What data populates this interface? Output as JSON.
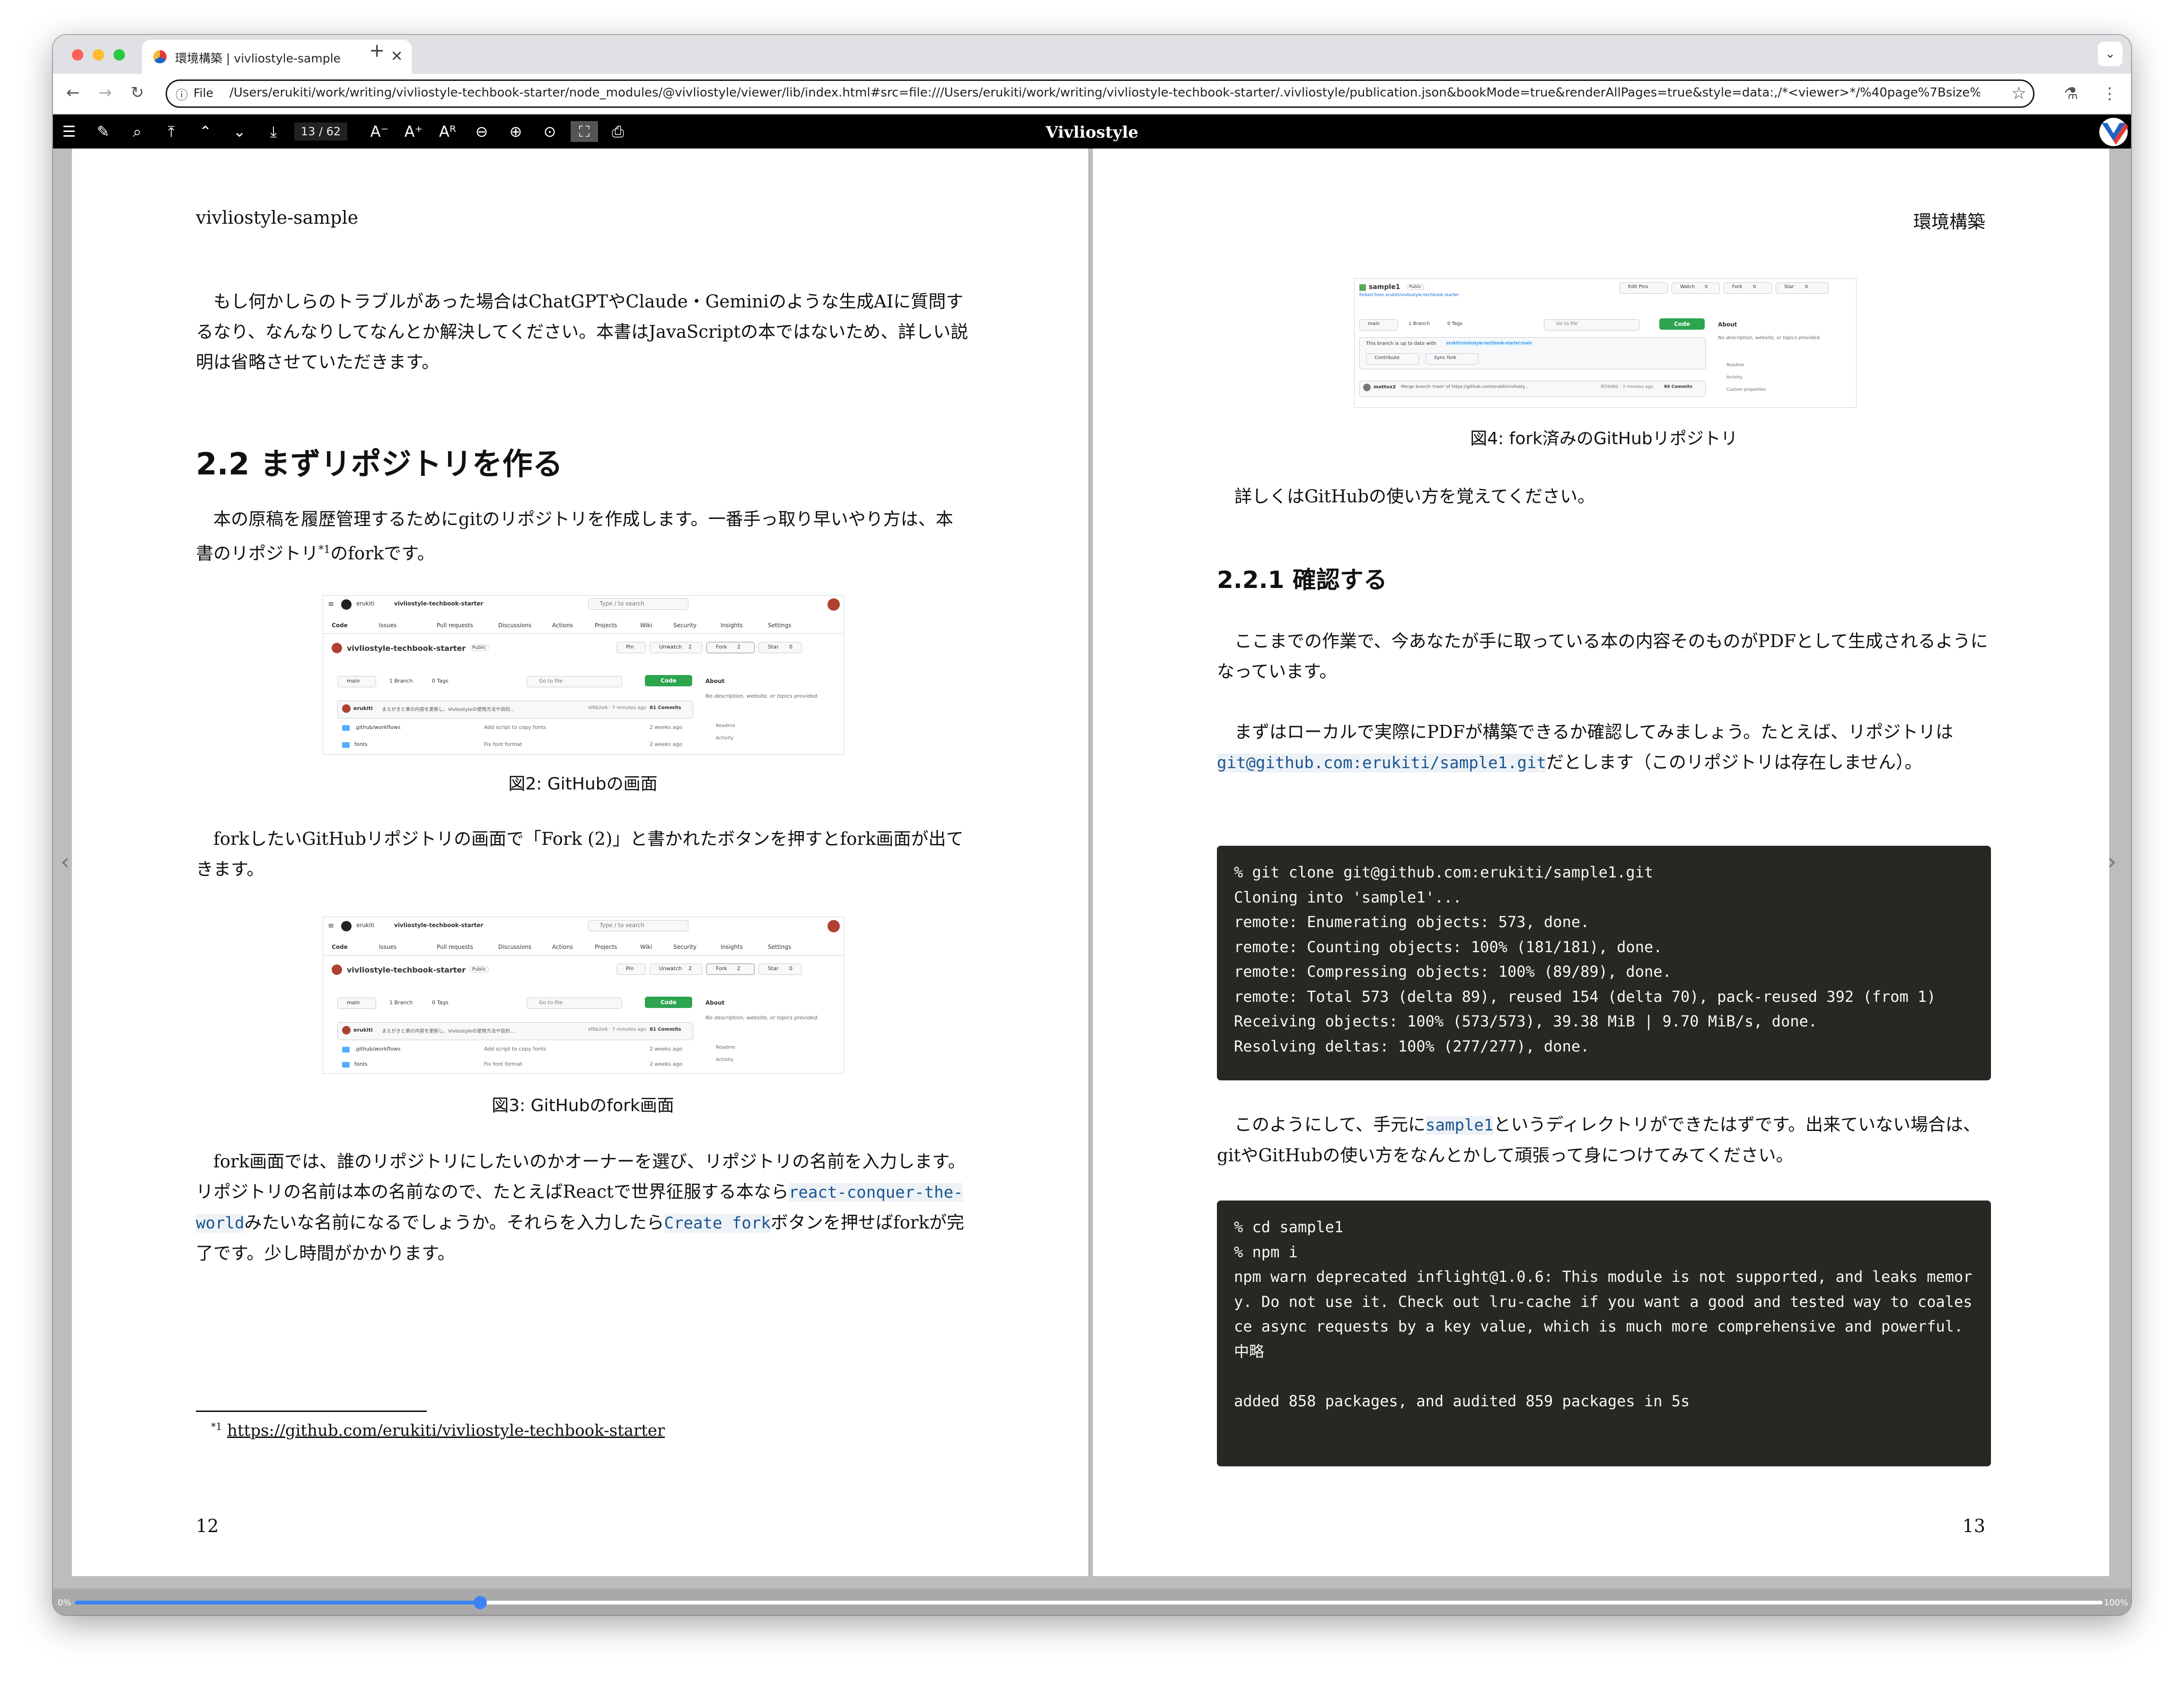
{
  "browser": {
    "tab_title": "環境構築 | vivliostyle-sample",
    "new_tab": "+",
    "chevron": "⌄",
    "omnibox_label": "File",
    "url": "/Users/erukiti/work/writing/vivliostyle-techbook-starter/node_modules/@vivliostyle/viewer/lib/index.html#src=file:///Users/erukiti/work/writing/vivliostyle-techbook-starter/.vivliostyle/publication.json&bookMode=true&renderAllPages=true&style=data:,/*<viewer>*/%40page%7Bsize%..."
  },
  "viewer": {
    "brand": "Vivliostyle",
    "page_indicator": "13 / 62",
    "progress_start": "0%",
    "progress_end": "100%",
    "progress_fraction": 0.2
  },
  "left_page": {
    "running_header": "vivliostyle-sample",
    "para1": "もし何かしらのトラブルがあった場合はChatGPTやClaude・Geminiのような生成AIに質問するなり、なんなりしてなんとか解決してください。本書はJavaScriptの本ではないため、詳しい説明は省略させていただきます。",
    "section_heading": "2.2 まずリポジトリを作る",
    "para2_pre": "本の原稿を履歴管理するためにgitのリポジトリを作成します。一番手っ取り早いやり方は、本書のリポジトリ",
    "para2_sup": "*1",
    "para2_post": "のforkです。",
    "fig2_caption": "図2: GitHubの画面",
    "para3": "forkしたいGitHubリポジトリの画面で「Fork (2)」と書かれたボタンを押すとfork画面が出てきます。",
    "fig3_caption": "図3: GitHubのfork画面",
    "para4_a": "fork画面では、誰のリポジトリにしたいのかオーナーを選び、リポジトリの名前を入力します。リポジトリの名前は本の名前なので、たとえばReactで世界征服する本なら",
    "para4_code1": "react-conquer-the-world",
    "para4_b": "みたいな名前になるでしょうか。それらを入力したら",
    "para4_code2": "Create fork",
    "para4_c": "ボタンを押せばforkが完了です。少し時間がかかります。",
    "footnote_mark": "*1",
    "footnote_url": "https://github.com/erukiti/vivliostyle-techbook-starter",
    "page_number": "12"
  },
  "github_shot": {
    "owner": "erukiti",
    "repo": "vivliostyle-techbook-starter",
    "search": "Type / to search",
    "tabs": [
      "Code",
      "Issues",
      "Pull requests",
      "Discussions",
      "Actions",
      "Projects",
      "Wiki",
      "Security",
      "Insights",
      "Settings"
    ],
    "issues_count": "10",
    "visibility": "Public",
    "pin": "Pin",
    "unwatch": "Unwatch",
    "unwatch_count": "2",
    "fork": "Fork",
    "fork_count": "2",
    "star": "Star",
    "star_count": "0",
    "branch": "main",
    "branches": "1 Branch",
    "tags": "0 Tags",
    "go_to_file": "Go to file",
    "code_btn": "Code",
    "about": "About",
    "about_desc": "No description, website, or topics provided.",
    "readme": "Readme",
    "activity": "Activity",
    "commit_author": "erukiti",
    "commit_msg": "まえがきと章の内容を更新し、Vivliostyleの使用方法や目的...",
    "commit_hash": "ef6b2e6 · 7 minutes ago",
    "commits": "81 Commits",
    "rows": [
      {
        "name": ".github/workflows",
        "msg": "Add script to copy fonts",
        "age": "2 weeks ago"
      },
      {
        "name": "fonts",
        "msg": "Fix font format",
        "age": "2 weeks ago"
      }
    ]
  },
  "fork_shot": {
    "repo": "sample1",
    "visibility": "Public",
    "forked_from": "forked from erukiti/vivliostyle-techbook-starter",
    "edit_pins": "Edit Pins",
    "watch": "Watch",
    "watch_count": "0",
    "fork": "Fork",
    "fork_count": "0",
    "star": "Star",
    "star_count": "0",
    "branch": "main",
    "branches": "1 Branch",
    "tags": "0 Tags",
    "go_to_file": "Go to file",
    "code_btn": "Code",
    "up_to_date": "This branch is up to date with",
    "up_to_date_ref": "erukiti/vivliostyle-techbook-starter:main",
    "contribute": "Contribute",
    "sync_fork": "Sync fork",
    "about": "About",
    "about_desc": "No description, website, or topics provided.",
    "readme": "Readme",
    "activity": "Activity",
    "custom_props": "Custom properties",
    "commit_author": "mottox2",
    "commit_msg": "Merge branch 'main' of https://github.com/erukiti/vivliosty...",
    "commit_hash": "9f29d82 · 3 minutes ago",
    "commits": "84 Commits"
  },
  "right_page": {
    "running_header": "環境構築",
    "fig4_caption": "図4: fork済みのGitHubリポジトリ",
    "para1": "詳しくはGitHubの使い方を覚えてください。",
    "subsection_heading": "2.2.1 確認する",
    "para2": "ここまでの作業で、今あなたが手に取っている本の内容そのものがPDFとして生成されるようになっています。",
    "para3_a": "まずはローカルで実際にPDFが構築できるか確認してみましょう。たとえば、リポジトリは",
    "para3_code": "git@github.com:erukiti/sample1.git",
    "para3_b": "だとします（このリポジトリは存在しません）。",
    "code1": "% git clone git@github.com:erukiti/sample1.git\nCloning into 'sample1'...\nremote: Enumerating objects: 573, done.\nremote: Counting objects: 100% (181/181), done.\nremote: Compressing objects: 100% (89/89), done.\nremote: Total 573 (delta 89), reused 154 (delta 70), pack-reused 392 (from 1)\nReceiving objects: 100% (573/573), 39.38 MiB | 9.70 MiB/s, done.\nResolving deltas: 100% (277/277), done.",
    "para4_a": "このようにして、手元に",
    "para4_code": "sample1",
    "para4_b": "というディレクトリができたはずです。出来ていない場合は、gitやGitHubの使い方をなんとかして頑張って身につけてみてください。",
    "code2": "% cd sample1\n% npm i\nnpm warn deprecated inflight@1.0.6: This module is not supported, and leaks memory. Do not use it. Check out lru-cache if you want a good and tested way to coalesce async requests by a key value, which is much more comprehensive and powerful.\n中略\n\nadded 858 packages, and audited 859 packages in 5s",
    "page_number": "13"
  },
  "colors": {
    "accent": "#3b82f6",
    "code_bg": "#272822",
    "toolbar_bg": "#000000",
    "github_green": "#2da44e"
  }
}
